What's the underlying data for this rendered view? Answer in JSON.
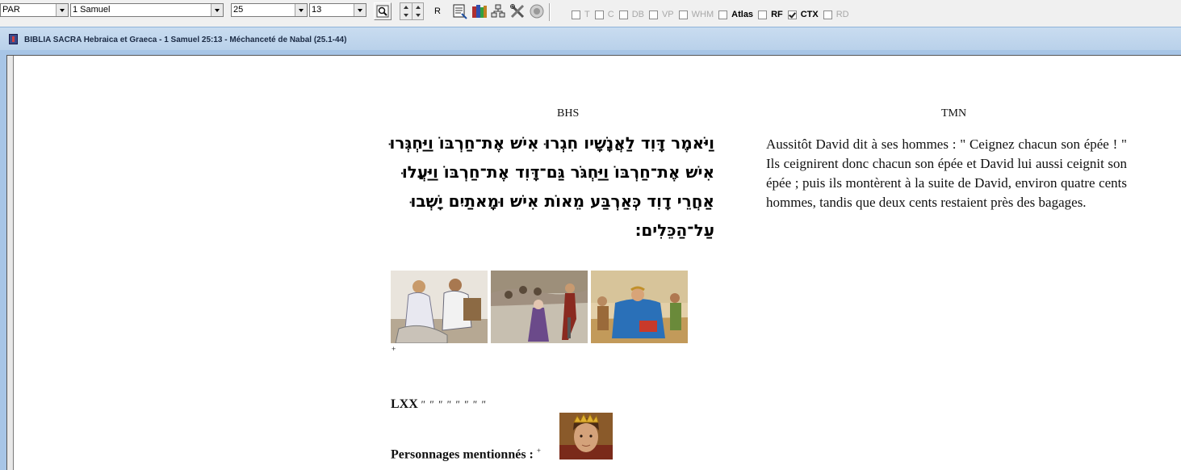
{
  "toolbar": {
    "mode_select": "PAR",
    "book_select": "1 Samuel",
    "chapter_select": "25",
    "verse_select": "13",
    "r_button_label": "R",
    "checkboxes": [
      {
        "label": "T",
        "checked": false
      },
      {
        "label": "C",
        "checked": false
      },
      {
        "label": "DB",
        "checked": false
      },
      {
        "label": "VP",
        "checked": false
      },
      {
        "label": "WHM",
        "checked": false
      },
      {
        "label": "Atlas",
        "checked": false
      },
      {
        "label": "RF",
        "checked": false
      },
      {
        "label": "CTX",
        "checked": true
      },
      {
        "label": "RD",
        "checked": false
      }
    ]
  },
  "window": {
    "title": "BIBLIA SACRA Hebraica et Graeca - 1 Samuel 25:13 - Méchanceté de Nabal (25.1-44)"
  },
  "content": {
    "bhs_heading": "BHS",
    "tmn_heading": "TMN",
    "hebrew_text": "וַיֹּאמֶר דָּוִד לַאֲנָשָׁיו חִגְרוּ אִישׁ אֶת־חַרְבּוֹ וַיַּחְגְּרוּ אִישׁ אֶת־חַרְבּוֹ וַיַּחְגֹּר גַּם־דָּוִד אֶת־חַרְבּוֹ וַיַּעֲלוּ אַחֲרֵי דָוִד כְּאַרְבַּע מֵאוֹת אִישׁ וּמָאתַיִם יָשְׁבוּ עַל־הַכֵּלִים׃",
    "french_text": "Aussitôt David dit à ses hommes : \" Ceignez chacun son épée ! \" Ils ceignirent donc chacun son épée et David lui aussi ceignit son épée ; puis ils montèrent à la suite de David, environ quatre cents hommes, tandis que deux cents restaient près des bagages.",
    "plus_marker": "+",
    "lxx_label": "LXX",
    "lxx_text": "\" \" \" \" \" \" \" \"",
    "persons_label": "Personnages mentionnés :",
    "persons_marker": "+"
  }
}
